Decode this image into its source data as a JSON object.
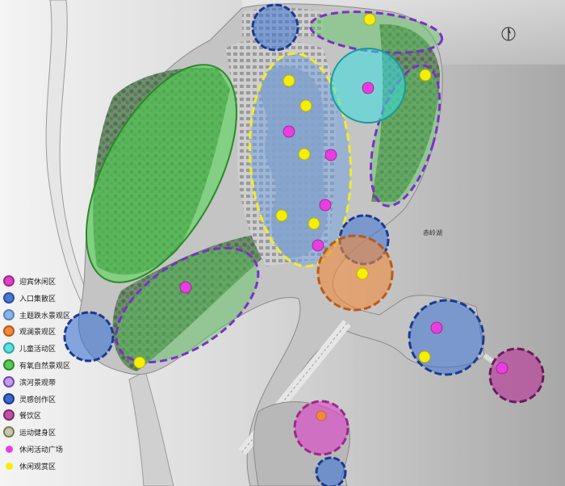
{
  "map_labels": {
    "water_label": "赤岭湖"
  },
  "legend": [
    {
      "label": "迎宾休闲区",
      "fill": "#e040c8",
      "stroke": "#9a2a8a",
      "kind": "circle"
    },
    {
      "label": "入口集散区",
      "fill": "#4a78d0",
      "stroke": "#2a4fa0",
      "kind": "circle"
    },
    {
      "label": "主题跌水景观区",
      "fill": "#8ab4e6",
      "stroke": "#5a80c0",
      "kind": "circle"
    },
    {
      "label": "观澜景观区",
      "fill": "#f08a3c",
      "stroke": "#b85a1a",
      "kind": "circle"
    },
    {
      "label": "儿童活动区",
      "fill": "#5fe0e0",
      "stroke": "#2aa8a8",
      "kind": "circle"
    },
    {
      "label": "有氧自然景观区",
      "fill": "#5cc85c",
      "stroke": "#2a8a2a",
      "kind": "circle"
    },
    {
      "label": "滨河景观带",
      "fill": "#c0a0e8",
      "stroke": "#7a40c0",
      "kind": "circle"
    },
    {
      "label": "灵感创作区",
      "fill": "#3a6acc",
      "stroke": "#1a3a90",
      "kind": "circle"
    },
    {
      "label": "餐饮区",
      "fill": "#c050a8",
      "stroke": "#7a2a6a",
      "kind": "circle"
    },
    {
      "label": "运动健身区",
      "fill": "#c8c8b0",
      "stroke": "#7a7a50",
      "kind": "circle"
    },
    {
      "label": "休闲活动广场",
      "fill": "#e83ee0",
      "stroke": "#e83ee0",
      "kind": "dot"
    },
    {
      "label": "休闲观赏区",
      "fill": "#f4f000",
      "stroke": "#f4f000",
      "kind": "dot"
    }
  ],
  "colors": {
    "background": "#d4d4d4",
    "water": "#bcbcbc",
    "dash_yellow": "#f2ec2a",
    "dash_purple": "#7a30c8",
    "dot_magenta": "#e83ee0",
    "dot_yellow": "#f4f000"
  },
  "icons": {
    "north_arrow": "north-arrow-icon"
  }
}
